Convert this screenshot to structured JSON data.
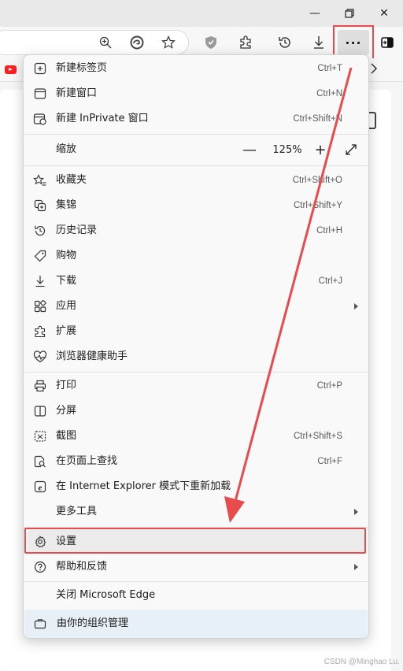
{
  "window": {
    "minimize_glyph": "—",
    "restore_icon": "restore-icon",
    "close_glyph": "✕"
  },
  "toolbar": {
    "icons": [
      "zoom-icon",
      "edge-copilot-icon",
      "star-favorite-icon",
      "shield-icon",
      "extensions-icon",
      "history-icon",
      "download-icon",
      "more-menu-icon",
      "sidebar-icon"
    ],
    "menu_button_label": "···"
  },
  "menu": {
    "items": [
      {
        "label": "新建标签页",
        "shortcut": "Ctrl+T"
      },
      {
        "label": "新建窗口",
        "shortcut": "Ctrl+N"
      },
      {
        "label": "新建 InPrivate 窗口",
        "shortcut": "Ctrl+Shift+N"
      },
      {
        "label": "缩放",
        "shortcut": ""
      },
      {
        "label": "收藏夹",
        "shortcut": "Ctrl+Shift+O"
      },
      {
        "label": "集锦",
        "shortcut": "Ctrl+Shift+Y"
      },
      {
        "label": "历史记录",
        "shortcut": "Ctrl+H"
      },
      {
        "label": "购物",
        "shortcut": ""
      },
      {
        "label": "下载",
        "shortcut": "Ctrl+J"
      },
      {
        "label": "应用",
        "shortcut": ""
      },
      {
        "label": "扩展",
        "shortcut": ""
      },
      {
        "label": "浏览器健康助手",
        "shortcut": ""
      },
      {
        "label": "打印",
        "shortcut": "Ctrl+P"
      },
      {
        "label": "分屏",
        "shortcut": ""
      },
      {
        "label": "截图",
        "shortcut": "Ctrl+Shift+S"
      },
      {
        "label": "在页面上查找",
        "shortcut": "Ctrl+F"
      },
      {
        "label": "在 Internet Explorer 模式下重新加载",
        "shortcut": ""
      },
      {
        "label": "更多工具",
        "shortcut": ""
      },
      {
        "label": "设置",
        "shortcut": ""
      },
      {
        "label": "帮助和反馈",
        "shortcut": ""
      },
      {
        "label": "关闭 Microsoft Edge",
        "shortcut": ""
      }
    ],
    "zoom": {
      "out": "—",
      "value": "125%",
      "in": "+"
    },
    "org_managed": "由你的组织管理"
  },
  "colors": {
    "highlight_red": "#e84b4b",
    "menu_bg": "#f9f9f9",
    "org_bg": "#e8f0f7"
  },
  "watermark": "CSDN @Minghao Lu."
}
